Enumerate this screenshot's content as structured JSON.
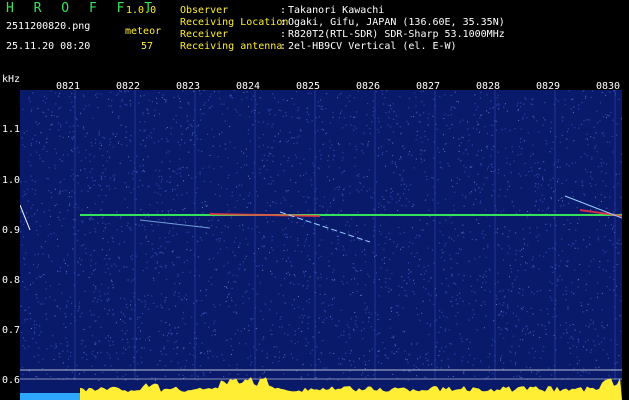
{
  "app": {
    "title": "H R O F F T",
    "version": "1.0.0",
    "event_type": "meteor"
  },
  "file": {
    "name": "2511200820.png",
    "datetime": "25.11.20 08:20",
    "count": "57"
  },
  "info": [
    {
      "label": "Observer",
      "value": "Takanori Kawachi"
    },
    {
      "label": "Receiving Location",
      "value": "Ogaki, Gifu, JAPAN (136.60E, 35.35N)"
    },
    {
      "label": "Receiver",
      "value": "R820T2(RTL-SDR) SDR-Sharp 53.1000MHz"
    },
    {
      "label": "Receiving antenna",
      "value": "2el-HB9CV Vertical (el. E-W)"
    }
  ],
  "axis": {
    "y_unit": "kHz",
    "x_ticks": [
      "0821",
      "0822",
      "0823",
      "0824",
      "0825",
      "0826",
      "0827",
      "0828",
      "0829",
      "0830"
    ],
    "y_ticks": [
      "1.1",
      "1.0",
      "0.9",
      "0.8",
      "0.7",
      "0.6"
    ]
  },
  "colors": {
    "background": "#0a1a6a",
    "signal": "#35e35a",
    "accent": "#ffee33",
    "hot": "#ff3344"
  }
}
